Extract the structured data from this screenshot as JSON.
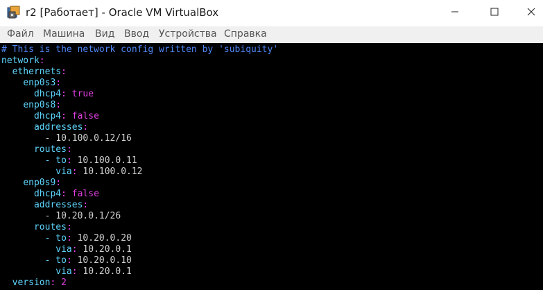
{
  "window": {
    "title": "r2 [Работает] - Oracle VM VirtualBox",
    "minimize_icon": "minimize-icon",
    "maximize_icon": "maximize-icon",
    "close_icon": "close-icon",
    "app_icon": "virtualbox-icon"
  },
  "menu": {
    "items": [
      "Файл",
      "Машина",
      "Вид",
      "Ввод",
      "Устройства",
      "Справка"
    ]
  },
  "terminal": {
    "comment": "# This is the network config written by 'subiquity'",
    "lines": [
      {
        "indent": "",
        "key": "network",
        "colon": ":",
        "value": ""
      },
      {
        "indent": "  ",
        "key": "ethernets",
        "colon": ":",
        "value": ""
      },
      {
        "indent": "    ",
        "key": "enp0s3",
        "colon": ":",
        "value": ""
      },
      {
        "indent": "      ",
        "key": "dhcp4",
        "colon": ":",
        "value": " true"
      },
      {
        "indent": "    ",
        "key": "enp0s8",
        "colon": ":",
        "value": ""
      },
      {
        "indent": "      ",
        "key": "dhcp4",
        "colon": ":",
        "value": " false"
      },
      {
        "indent": "      ",
        "key": "addresses",
        "colon": ":",
        "value": ""
      },
      {
        "indent": "        ",
        "key": "",
        "colon": "",
        "value": "- 10.100.0.12/16"
      },
      {
        "indent": "      ",
        "key": "routes",
        "colon": ":",
        "value": ""
      },
      {
        "indent": "        ",
        "key": "- to",
        "colon": ":",
        "value": " 10.100.0.11"
      },
      {
        "indent": "          ",
        "key": "via",
        "colon": ":",
        "value": " 10.100.0.12"
      },
      {
        "indent": "    ",
        "key": "enp0s9",
        "colon": ":",
        "value": ""
      },
      {
        "indent": "      ",
        "key": "dhcp4",
        "colon": ":",
        "value": " false"
      },
      {
        "indent": "      ",
        "key": "addresses",
        "colon": ":",
        "value": ""
      },
      {
        "indent": "        ",
        "key": "",
        "colon": "",
        "value": "- 10.20.0.1/26"
      },
      {
        "indent": "      ",
        "key": "routes",
        "colon": ":",
        "value": ""
      },
      {
        "indent": "        ",
        "key": "- to",
        "colon": ":",
        "value": " 10.20.0.20"
      },
      {
        "indent": "          ",
        "key": "via",
        "colon": ":",
        "value": " 10.20.0.1"
      },
      {
        "indent": "        ",
        "key": "- to",
        "colon": ":",
        "value": " 10.20.0.10"
      },
      {
        "indent": "          ",
        "key": "via",
        "colon": ":",
        "value": " 10.20.0.1"
      },
      {
        "indent": "  ",
        "key": "version",
        "colon": ":",
        "value": " 2"
      }
    ]
  }
}
